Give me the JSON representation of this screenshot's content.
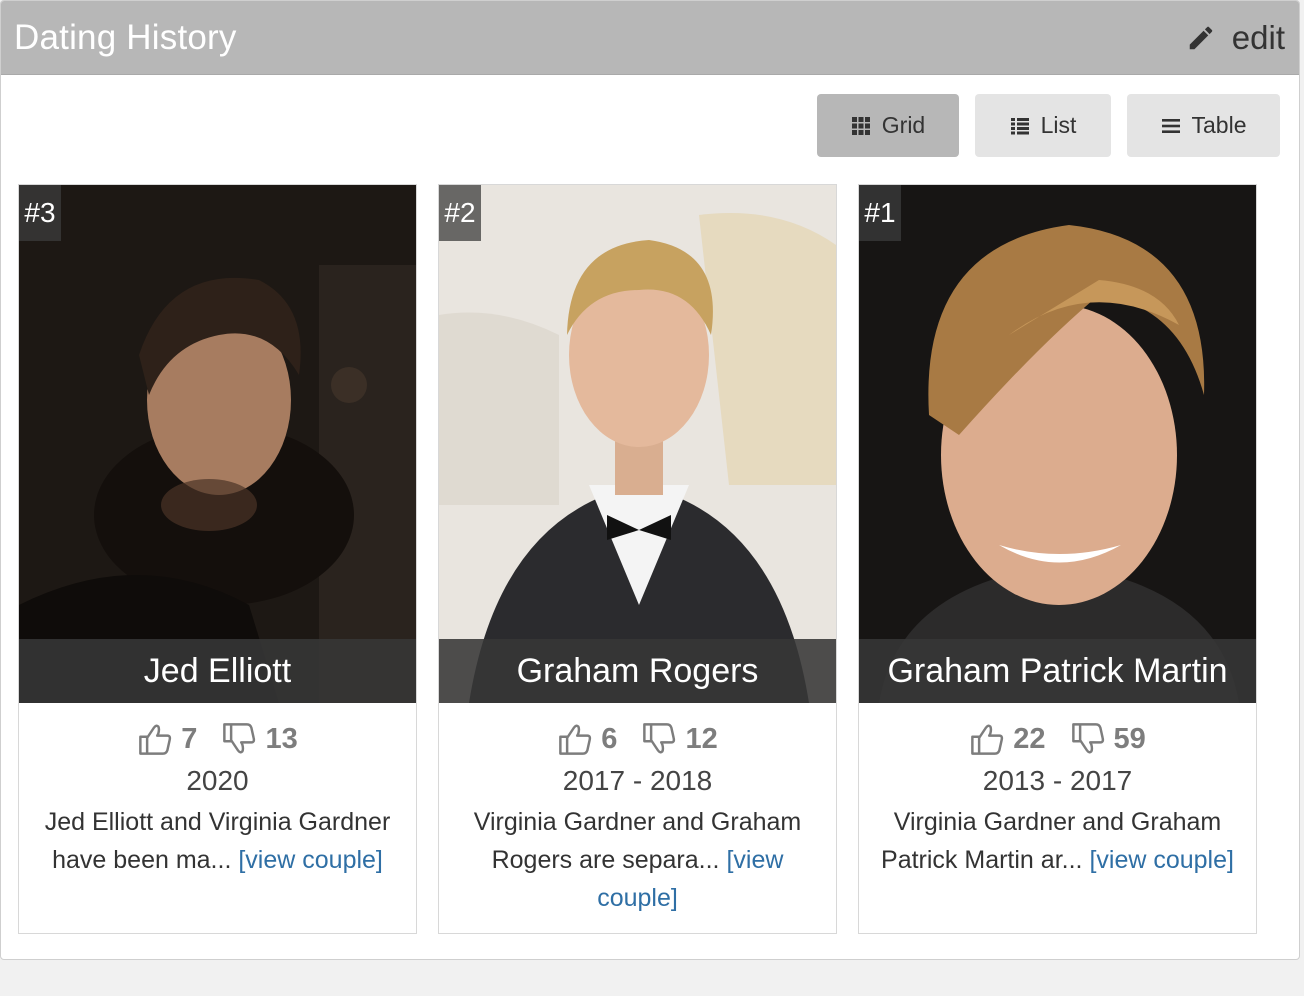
{
  "header": {
    "title": "Dating History",
    "edit_label": "edit"
  },
  "view_buttons": [
    {
      "label": "Grid",
      "icon": "grid-icon",
      "active": true
    },
    {
      "label": "List",
      "icon": "list-icon",
      "active": false
    },
    {
      "label": "Table",
      "icon": "table-icon",
      "active": false
    }
  ],
  "cards": [
    {
      "rank": "#3",
      "name": "Jed Elliott",
      "likes": "7",
      "dislikes": "13",
      "years": "2020",
      "description": "Jed Elliott and Virginia Gardner have been ma...",
      "link_label": "[view couple]"
    },
    {
      "rank": "#2",
      "name": "Graham Rogers",
      "likes": "6",
      "dislikes": "12",
      "years": "2017 - 2018",
      "description": "Virginia Gardner and Graham Rogers are separa...",
      "link_label": "[view couple]"
    },
    {
      "rank": "#1",
      "name": "Graham Patrick Martin",
      "likes": "22",
      "dislikes": "59",
      "years": "2013 - 2017",
      "description": "Virginia Gardner and Graham Patrick Martin ar...",
      "link_label": "[view couple]"
    }
  ],
  "colors": {
    "header_bg": "#b7b7b7",
    "active_button": "#b7b7b7",
    "button_bg": "#e4e4e4",
    "link": "#2f6fa5",
    "vote_gray": "#7d7d7d"
  }
}
